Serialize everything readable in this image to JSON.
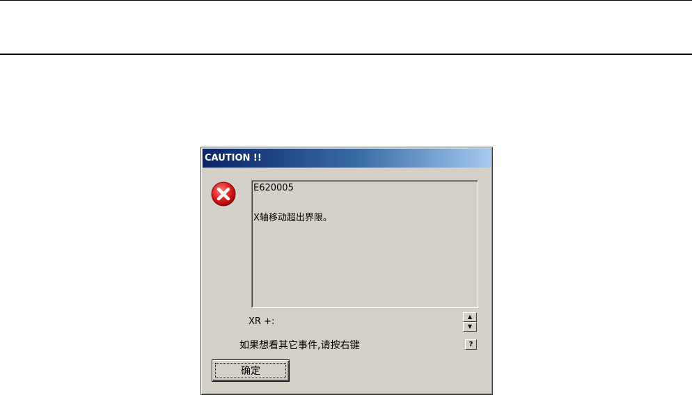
{
  "dialog": {
    "title": "CAUTION !!",
    "message_code": "E620005",
    "message_text": "X轴移动超出界限。",
    "axis_label": "XR +:",
    "hint": "如果想看其它事件,请按右键",
    "help_label": "?",
    "spin_up_glyph": "▲",
    "spin_down_glyph": "▼",
    "ok_label": "确定",
    "icon": "error-icon",
    "colors": {
      "title_gradient_start": "#0a246a",
      "title_gradient_end": "#a6caf0",
      "error_red": "#e02020",
      "face": "#d4d0c8"
    }
  }
}
